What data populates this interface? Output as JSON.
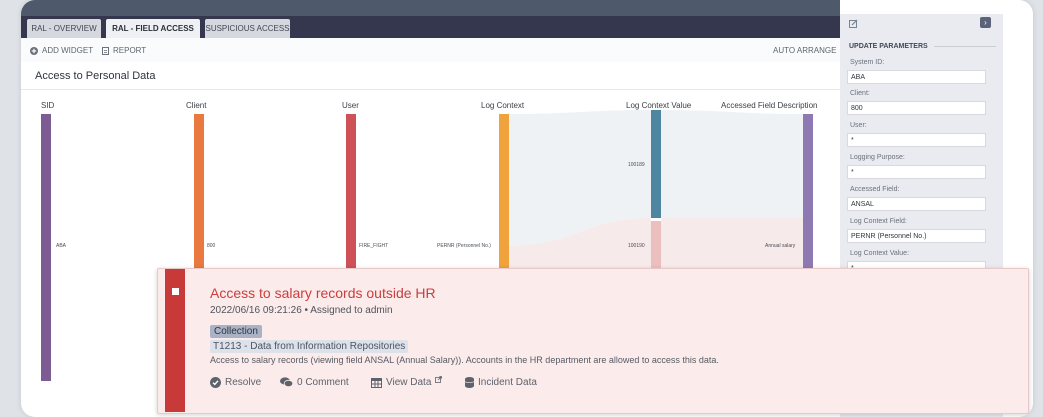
{
  "tabs": [
    {
      "label": "RAL - OVERVIEW",
      "active": false
    },
    {
      "label": "RAL - FIELD ACCESS",
      "active": true
    },
    {
      "label": "SUSPICIOUS ACCESS",
      "active": false
    }
  ],
  "toolbar": {
    "add_widget": "ADD WIDGET",
    "report": "REPORT",
    "auto_arrange": "AUTO ARRANGE"
  },
  "dashboard": {
    "title": "Access to Personal Data",
    "columns": [
      "SID",
      "Client",
      "User",
      "Log Context",
      "Log Context Value",
      "Accessed Field Description"
    ],
    "values": [
      "ABA",
      "800",
      "FIRE_FIGHT",
      "PERNR (Personnel No.)",
      "100189",
      "100190",
      "Annual salary"
    ]
  },
  "colors": {
    "sid": "#7d5c93",
    "client": "#e9793e",
    "user": "#cf5158",
    "log_context": "#f0a23c",
    "value_top": "#4e86a2",
    "value_bottom": "#ecbfbf",
    "field": "#8f79b3",
    "alert_accent": "#c83a3a"
  },
  "parameters": {
    "heading": "UPDATE PARAMETERS",
    "fields": [
      {
        "label": "System ID:",
        "value": "ABA"
      },
      {
        "label": "Client:",
        "value": "800"
      },
      {
        "label": "User:",
        "value": "*"
      },
      {
        "label": "Logging Purpose:",
        "value": "*"
      },
      {
        "label": "Accessed Field:",
        "value": "ANSAL"
      },
      {
        "label": "Log Context Field:",
        "value": "PERNR (Personnel No.)"
      },
      {
        "label": "Log Context Value:",
        "value": "*"
      }
    ]
  },
  "alert": {
    "title": "Access to salary records outside HR",
    "meta": "2022/06/16 09:21:26 • Assigned to admin",
    "tactic": "Collection",
    "technique": "T1213 - Data from Information Repositories",
    "description": "Access to salary records (viewing field ANSAL (Annual Salary)). Accounts in the HR department are allowed to access this data.",
    "actions": {
      "resolve": "Resolve",
      "comment": "0 Comment",
      "view_data": "View Data",
      "incident_data": "Incident Data"
    }
  },
  "icons": [
    "plus-circle-icon",
    "report-icon",
    "edit-icon",
    "chevron-right-icon",
    "check-circle-icon",
    "comment-icon",
    "table-icon",
    "external-link-icon",
    "database-icon"
  ]
}
